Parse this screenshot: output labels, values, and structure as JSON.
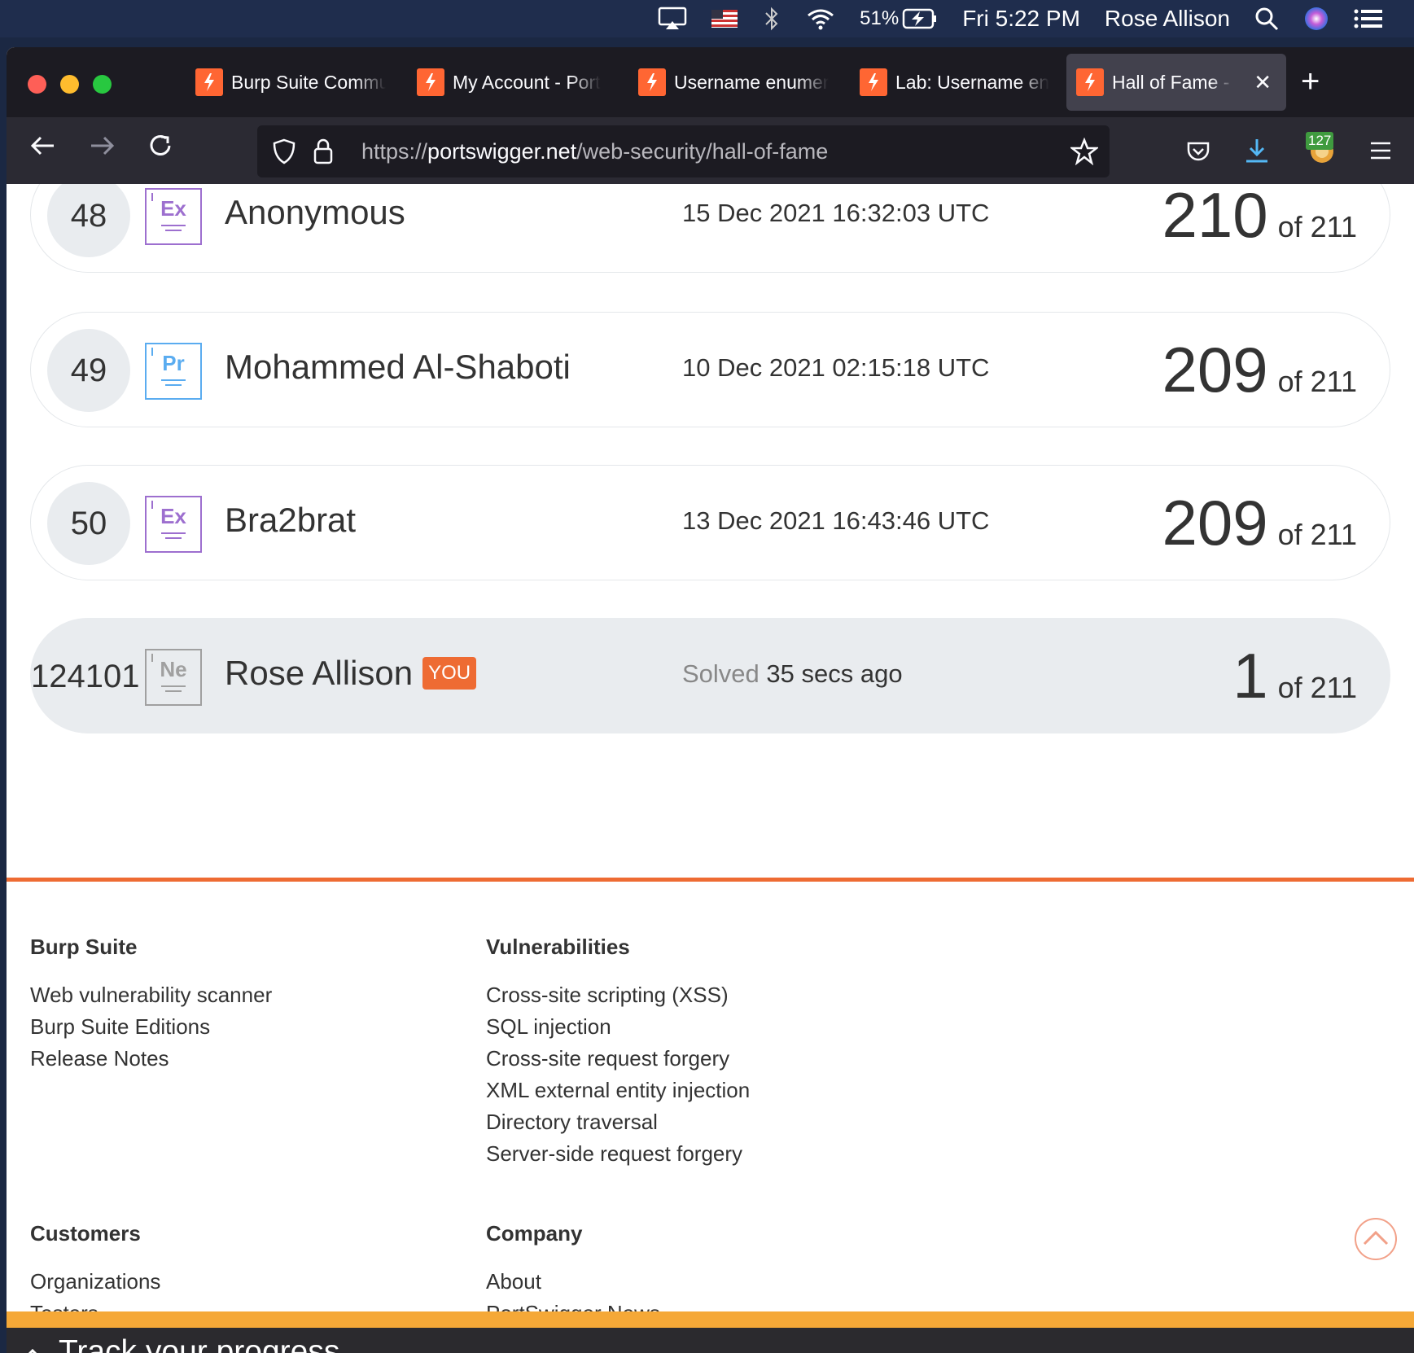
{
  "menubar": {
    "battery": "51%",
    "clock": "Fri 5:22 PM",
    "user": "Rose Allison"
  },
  "tabs": [
    {
      "label": "Burp Suite Commu"
    },
    {
      "label": "My Account - Port"
    },
    {
      "label": "Username enumer"
    },
    {
      "label": "Lab: Username en"
    },
    {
      "label": "Hall of Fame - W"
    }
  ],
  "urlbar": {
    "scheme": "https://",
    "domain": "portswigger.net",
    "path": "/web-security/hall-of-fame"
  },
  "extension_badge": "127",
  "leaderboard": [
    {
      "rank": "48",
      "badge": "Ex",
      "name": "Anonymous",
      "date": "15 Dec 2021 16:32:03 UTC",
      "score": "210",
      "of": "of 211"
    },
    {
      "rank": "49",
      "badge": "Pr",
      "name": "Mohammed Al-Shaboti",
      "date": "10 Dec 2021 02:15:18 UTC",
      "score": "209",
      "of": "of 211"
    },
    {
      "rank": "50",
      "badge": "Ex",
      "name": "Bra2brat",
      "date": "13 Dec 2021 16:43:46 UTC",
      "score": "209",
      "of": "of 211"
    },
    {
      "rank": "124101",
      "badge": "Ne",
      "name": "Rose Allison",
      "you": "YOU",
      "solved_label": "Solved",
      "date": "35 secs ago",
      "score": "1",
      "of": "of 211"
    }
  ],
  "footer": {
    "burp": {
      "title": "Burp Suite",
      "links": [
        "Web vulnerability scanner",
        "Burp Suite Editions",
        "Release Notes"
      ]
    },
    "vulns": {
      "title": "Vulnerabilities",
      "links": [
        "Cross-site scripting (XSS)",
        "SQL injection",
        "Cross-site request forgery",
        "XML external entity injection",
        "Directory traversal",
        "Server-side request forgery"
      ]
    },
    "customers": {
      "title": "Customers",
      "links": [
        "Organizations",
        "Testers"
      ]
    },
    "company": {
      "title": "Company",
      "links": [
        "About",
        "PortSwigger News"
      ]
    }
  },
  "progress": {
    "label": "Track your progress"
  },
  "colors": {
    "accent": "#ee6b33",
    "progress_bar": "#f5a837",
    "expert": "#9d6fcf",
    "practitioner": "#5aacf0",
    "newcomer": "#a0a0a0"
  }
}
